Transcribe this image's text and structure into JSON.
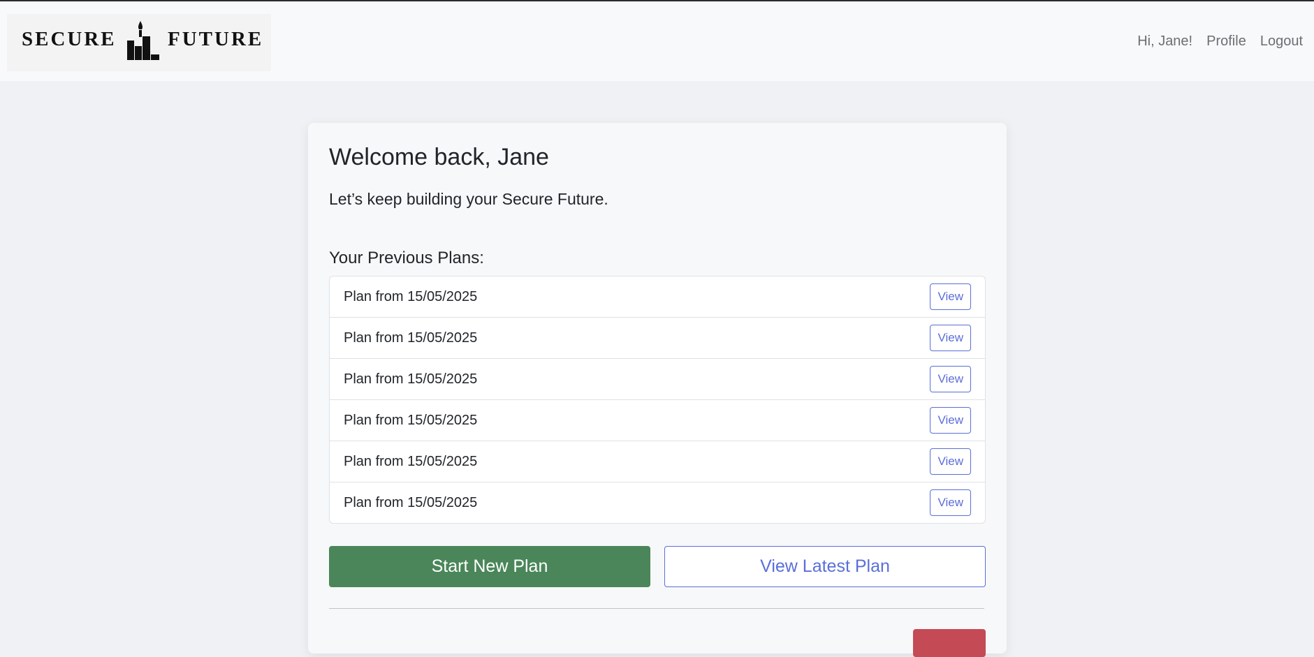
{
  "brand": {
    "left_word": "SECURE",
    "right_word": "FUTURE",
    "logo_icon": "building-blocks-flame-icon"
  },
  "nav": {
    "greeting": "Hi, Jane!",
    "profile": "Profile",
    "logout": "Logout"
  },
  "main": {
    "welcome": "Welcome back, Jane",
    "subtitle": "Let’s keep building your Secure Future.",
    "previous_plans_title": "Your Previous Plans:",
    "plans": [
      {
        "label": "Plan from 15/05/2025",
        "action": "View"
      },
      {
        "label": "Plan from 15/05/2025",
        "action": "View"
      },
      {
        "label": "Plan from 15/05/2025",
        "action": "View"
      },
      {
        "label": "Plan from 15/05/2025",
        "action": "View"
      },
      {
        "label": "Plan from 15/05/2025",
        "action": "View"
      },
      {
        "label": "Plan from 15/05/2025",
        "action": "View"
      }
    ],
    "start_new_plan": "Start New Plan",
    "view_latest_plan": "View Latest Plan"
  },
  "colors": {
    "primary_green": "#4a8659",
    "accent_blue": "#5a6fd8",
    "danger_red": "#c44a55"
  }
}
